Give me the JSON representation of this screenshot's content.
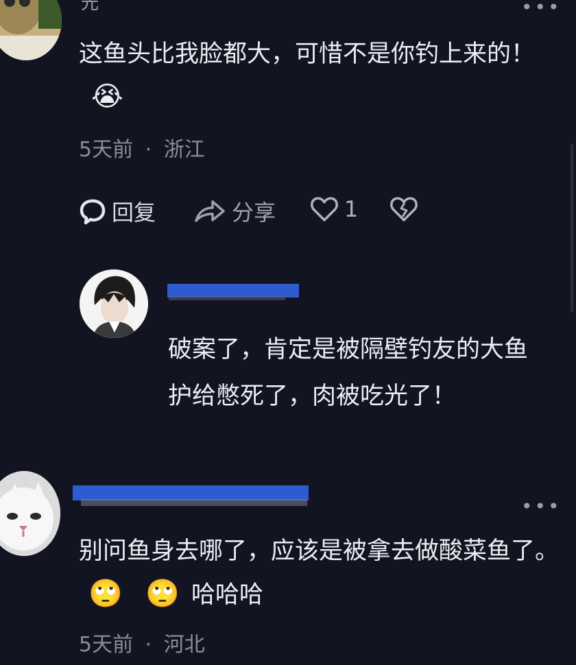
{
  "comment1": {
    "username_partial": "光",
    "text": "这鱼头比我脸都大，可惜不是你钓上来的！",
    "emoji": "😭",
    "time": "5天前",
    "sep": "·",
    "location": "浙江",
    "reply_label": "回复",
    "share_label": "分享",
    "like_count": "1"
  },
  "reply1": {
    "text": "破案了，肯定是被隔壁钓友的大鱼护给憋死了，肉被吃光了！"
  },
  "comment2": {
    "text": "别问鱼身去哪了，应该是被拿去做酸菜鱼了。",
    "emoji1": "🙄",
    "emoji2": "🙄",
    "laugh": "哈哈哈",
    "time": "5天前",
    "sep": "·",
    "location": "河北"
  },
  "colors": {
    "background": "#121422",
    "text": "#eceef3",
    "meta": "#8b8e99",
    "redaction": "#2f5bd0"
  }
}
